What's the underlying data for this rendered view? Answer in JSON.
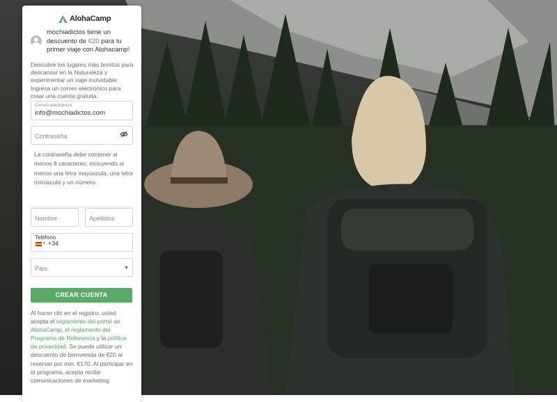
{
  "brand": {
    "name": "AlohaCamp",
    "accent": "#5aab65",
    "link_color": "#4aa45a"
  },
  "promo": {
    "prefix": "mochiadictos tiene un descuento de ",
    "amount": "€20",
    "suffix": " para tu primer viaje con Alohacamp!"
  },
  "intro": "Descubre los lugares más bonitos para descansar en la Naturaleza y experimentar un viaje inolvidable. Ingresa un correo electrónico para crear una cuenta gratuita.",
  "form": {
    "email_label": "Correo electrónico",
    "email_value": "info@mochiadictos.com",
    "password_placeholder": "Contraseña",
    "password_hint": "La contraseña debe contener al menos 8 caracteres, incluyendo al menos una letra mayúscula, una letra minúscula y un número.",
    "first_name_placeholder": "Nombre",
    "last_name_placeholder": "Apellidos",
    "phone_label": "Teléfono",
    "phone_code": "+34",
    "country_placeholder": "País",
    "submit_label": "CREAR CUENTA"
  },
  "legal": {
    "t1": "Al hacer clic en el registro, usted acepta el ",
    "l1": "reglamento del portal de AlohaCamp",
    "t2": ", ",
    "l2": "el reglamento del Programa de Referencia",
    "t3": " y la ",
    "l3": "política de privacidad",
    "t4": ". Se puede utilizar un descuento de bienvenida de €20 al reservar por min. €170. Al participar en el programa, acepta recibir comunicaciones de marketing."
  },
  "icons": [
    "tent-logo-icon",
    "user-avatar-icon",
    "eye-off-icon",
    "spain-flag-icon",
    "chevron-down-icon"
  ]
}
